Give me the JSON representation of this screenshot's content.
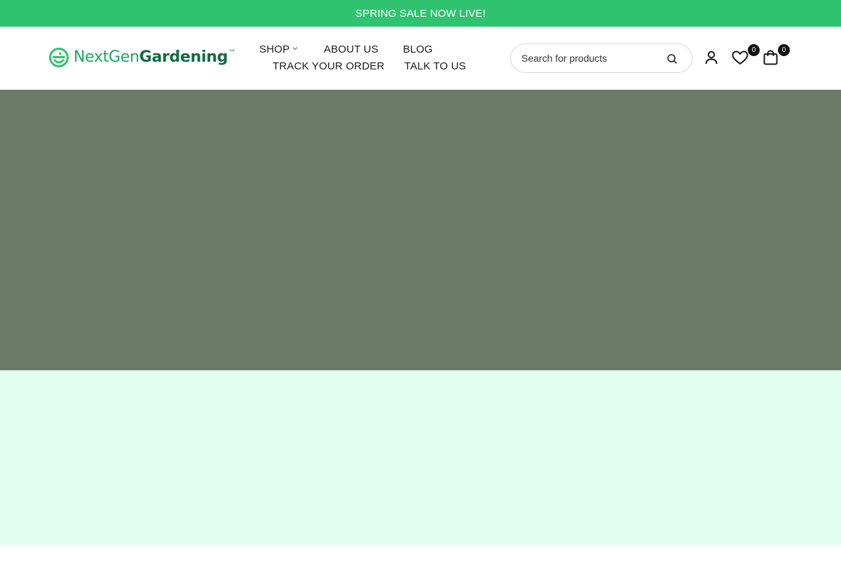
{
  "announcement": {
    "text": "SPRING SALE NOW LIVE!"
  },
  "brand": {
    "name_light": "NextGen",
    "name_bold": "Gardening",
    "trademark": "™",
    "color_primary": "#1aa862",
    "color_dark": "#136b45"
  },
  "nav": {
    "shop": "SHOP",
    "about": "ABOUT US",
    "blog": "BLOG",
    "track": "TRACK YOUR ORDER",
    "talk": "TALK TO US"
  },
  "search": {
    "placeholder": "Search for products",
    "value": ""
  },
  "header_icons": {
    "account": "user-icon",
    "wishlist": "heart-icon",
    "wishlist_count": "0",
    "cart": "shopping-bag-icon",
    "cart_count": "0"
  },
  "colors": {
    "announcement_bg": "#2fc26f",
    "hero_bg": "#6b7a67",
    "section_bg": "#e1fef0"
  }
}
